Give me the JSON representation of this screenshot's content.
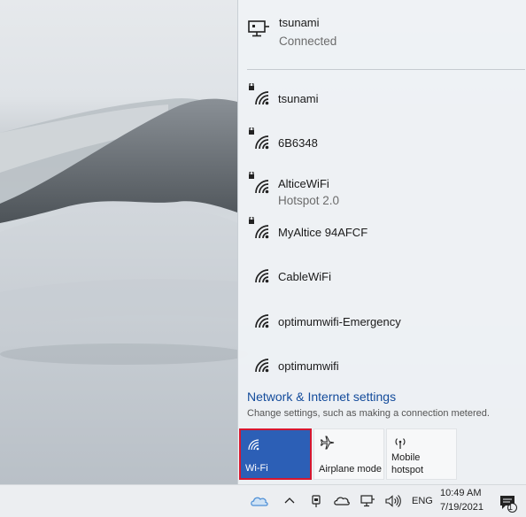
{
  "connected_network": {
    "name": "tsunami",
    "status": "Connected",
    "icon": "ethernet-monitor-icon"
  },
  "networks": [
    {
      "name": "tsunami",
      "sub": "",
      "secured": true,
      "icon": "wifi-secured-icon"
    },
    {
      "name": "6B6348",
      "sub": "",
      "secured": true,
      "icon": "wifi-secured-icon"
    },
    {
      "name": "AlticeWiFi",
      "sub": "Hotspot 2.0",
      "secured": true,
      "icon": "wifi-secured-icon"
    },
    {
      "name": "MyAltice 94AFCF",
      "sub": "",
      "secured": true,
      "icon": "wifi-secured-icon"
    },
    {
      "name": "CableWiFi",
      "sub": "",
      "secured": false,
      "icon": "wifi-icon"
    },
    {
      "name": "optimumwifi-Emergency",
      "sub": "",
      "secured": false,
      "icon": "wifi-icon"
    },
    {
      "name": "optimumwifi",
      "sub": "",
      "secured": false,
      "icon": "wifi-icon"
    }
  ],
  "settings": {
    "link": "Network & Internet settings",
    "description": "Change settings, such as making a connection metered."
  },
  "quick_actions": {
    "wifi": {
      "label": "Wi-Fi",
      "active": true,
      "icon": "wifi-icon"
    },
    "airplane": {
      "label": "Airplane mode",
      "active": false,
      "icon": "airplane-icon"
    },
    "hotspot": {
      "label": "Mobile\nhotspot",
      "label_line1": "Mobile",
      "label_line2": "hotspot",
      "active": false,
      "icon": "hotspot-icon"
    }
  },
  "taskbar": {
    "language": "ENG",
    "time": "10:49 AM",
    "date": "7/19/2021",
    "notification_count": "1",
    "icons": [
      "onedrive-icon",
      "chevron-up-icon",
      "usb-icon",
      "cloud-icon",
      "network-icon",
      "volume-icon",
      "notification-icon"
    ]
  },
  "colors": {
    "accent": "#2c5fb6",
    "highlight_border": "#d7172f",
    "link": "#134b9b"
  }
}
